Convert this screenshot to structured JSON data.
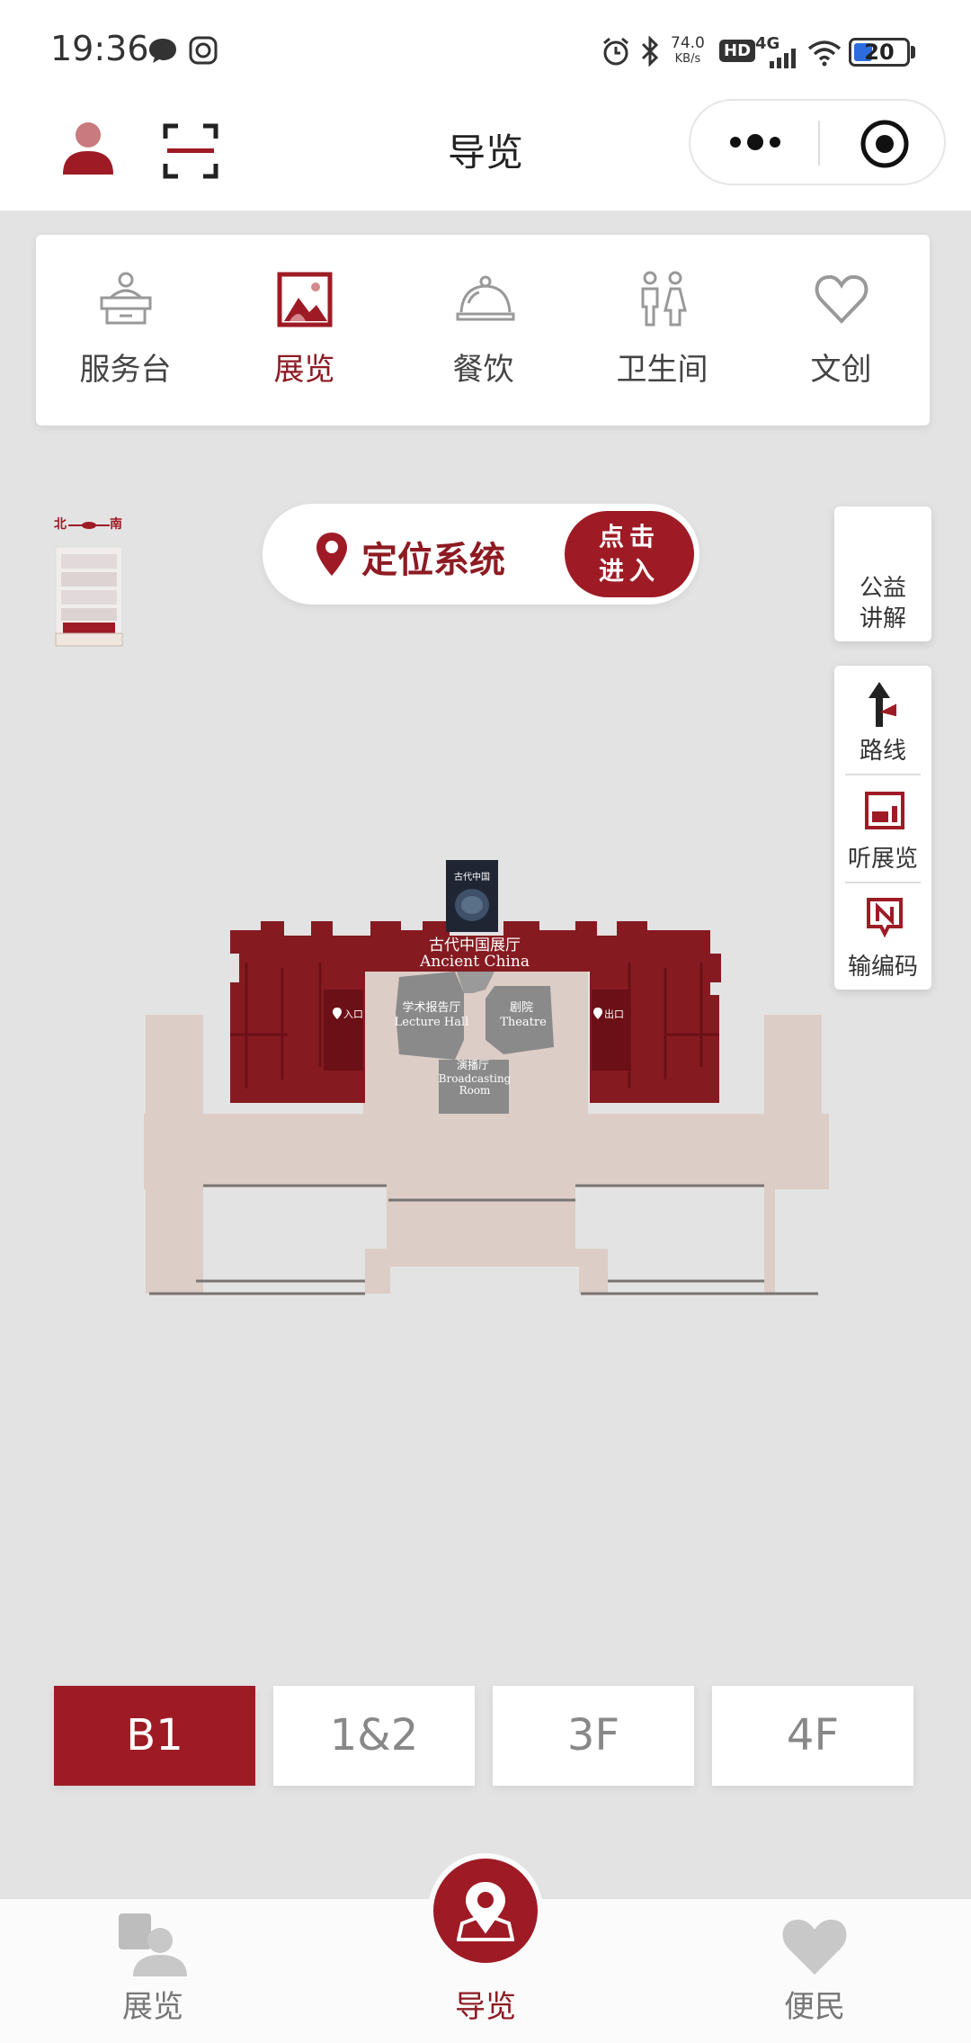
{
  "status_bar": {
    "time": "19:36",
    "speed_value": "74.0",
    "speed_unit": "KB/s",
    "hd": "HD",
    "network": "4G",
    "battery": "20"
  },
  "header": {
    "title": "导览",
    "icons": [
      "user-icon",
      "scan-icon",
      "more-icon",
      "target-icon"
    ]
  },
  "categories": [
    {
      "label": "服务台",
      "icon": "service-desk-icon",
      "active": false
    },
    {
      "label": "展览",
      "icon": "exhibition-picture-icon",
      "active": true
    },
    {
      "label": "餐饮",
      "icon": "dining-cloche-icon",
      "active": false
    },
    {
      "label": "卫生间",
      "icon": "restroom-icon",
      "active": false
    },
    {
      "label": "文创",
      "icon": "heart-icon",
      "active": false
    }
  ],
  "mini_map": {
    "north": "北",
    "south": "南"
  },
  "locate": {
    "label": "定位系统",
    "button_line1": "点击",
    "button_line2": "进入"
  },
  "side": {
    "guide_line1": "公益",
    "guide_line2": "讲解",
    "tools": [
      {
        "label": "路线",
        "icon": "route-arrow-icon"
      },
      {
        "label": "听展览",
        "icon": "audio-exhibition-icon"
      },
      {
        "label": "输编码",
        "icon": "code-input-icon"
      }
    ]
  },
  "map_labels": {
    "ancient_cn": "古代中国展厅",
    "ancient_en": "Ancient  China",
    "lecture_cn": "学术报告厅",
    "lecture_en": "Lecture  Hall",
    "theatre_cn": "剧院",
    "theatre_en": "Theatre",
    "broadcast_cn": "演播厅",
    "broadcast_en1": "Broadcasting",
    "broadcast_en2": "Room",
    "entrance": "入口",
    "exit": "出口",
    "poster_title": "古代中国"
  },
  "floors": [
    {
      "label": "B1",
      "active": true
    },
    {
      "label": "1&2",
      "active": false
    },
    {
      "label": "3F",
      "active": false
    },
    {
      "label": "4F",
      "active": false
    }
  ],
  "bottom_nav": [
    {
      "label": "展览",
      "icon": "exhibition-nav-icon",
      "active": false
    },
    {
      "label": "导览",
      "icon": "guide-location-icon",
      "active": true
    },
    {
      "label": "便民",
      "icon": "heart-nav-icon",
      "active": false
    }
  ],
  "colors": {
    "brand_red": "#9e1b25",
    "map_red": "#851b21",
    "map_beige": "#dccdc6",
    "map_gray": "#8a8a8a"
  }
}
